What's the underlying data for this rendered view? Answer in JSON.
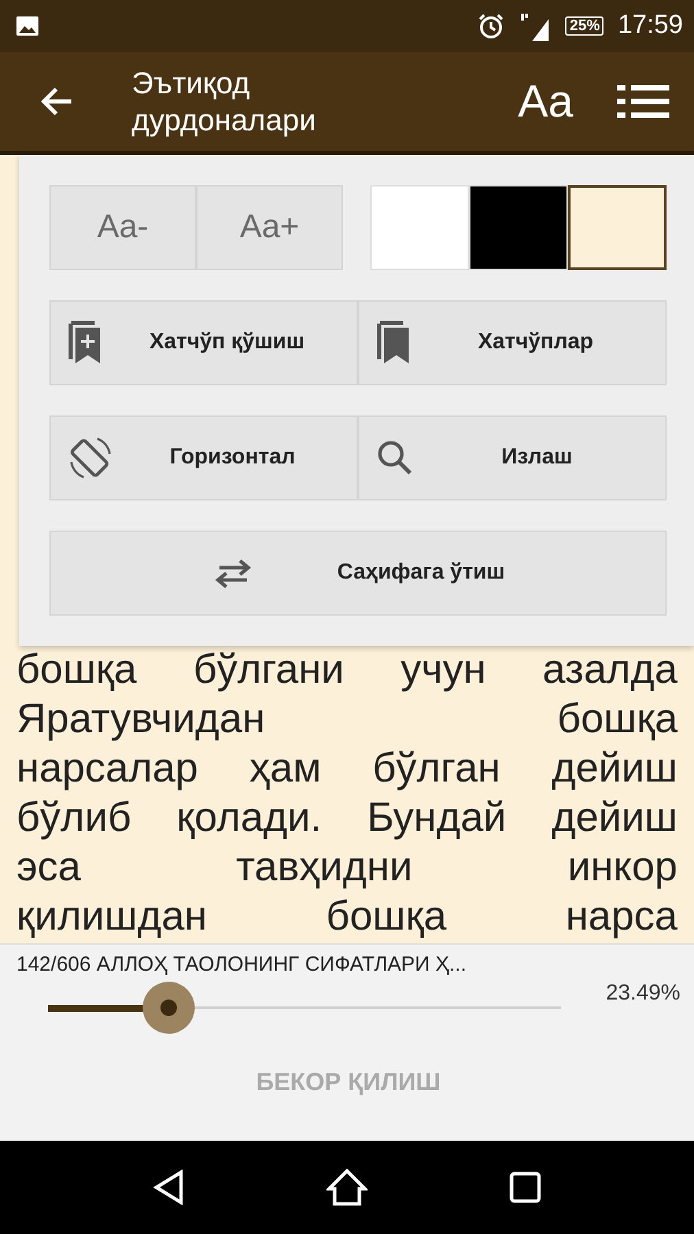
{
  "status_bar": {
    "battery": "25%",
    "time": "17:59"
  },
  "app_bar": {
    "title": "Эътиқод дурдоналари",
    "font_button": "Aa"
  },
  "settings_panel": {
    "font_size_buttons": [
      "Aa-",
      "Aa+"
    ],
    "themes": [
      {
        "color": "#ffffff",
        "selected": false
      },
      {
        "color": "#000000",
        "selected": false
      },
      {
        "color": "#fcf0d8",
        "selected": true
      }
    ],
    "actions": [
      {
        "kind": "bookmark-add",
        "label": "Хатчўп қўшиш"
      },
      {
        "kind": "bookmarks",
        "label": "Хатчўплар"
      },
      {
        "kind": "rotate",
        "label": "Горизонтал"
      },
      {
        "kind": "search",
        "label": "Излаш"
      },
      {
        "kind": "swap",
        "label": "Саҳифага ўтиш"
      }
    ]
  },
  "reading_text": [
    "бошқа бўлгани учун азалда",
    "Яратувчидан бошқа",
    "нарсалар ҳам бўлган дейиш",
    "бўлиб қолади. Бундай дейиш",
    "эса тавҳидни инкор",
    "қилишдан бошқа нарса"
  ],
  "progress": {
    "chapter": "142/606 АЛЛОҲ ТАОЛОНИНГ СИФАТЛАРИ Ҳ...",
    "level": 0.2349,
    "percent": "23.49%"
  },
  "cancel_button": "БЕКОР ҚИЛИШ"
}
